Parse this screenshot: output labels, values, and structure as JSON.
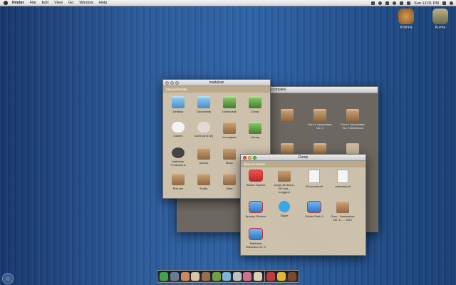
{
  "menubar": {
    "app": "Finder",
    "items": [
      "File",
      "Edit",
      "View",
      "Go",
      "Window",
      "Help"
    ],
    "clock": "Sun 12:01 PM"
  },
  "desktop": {
    "icons": [
      {
        "label": "Krishna"
      },
      {
        "label": "Kurma"
      }
    ]
  },
  "win_mattahan": {
    "title": "mattahan",
    "sidebar_header": "Shared Folder",
    "items": [
      {
        "label": "Desktop",
        "icon": "folder-blue"
      },
      {
        "label": "Documents",
        "icon": "folder-blue"
      },
      {
        "label": "Downloads",
        "icon": "folder-green"
      },
      {
        "label": "Dump",
        "icon": "folder-green"
      },
      {
        "label": "Games",
        "icon": "glove"
      },
      {
        "label": "Icons (and Wi)",
        "icon": "bird"
      },
      {
        "label": "Incomplete",
        "icon": "folder"
      },
      {
        "label": "Library",
        "icon": "folder-green"
      },
      {
        "label": "Mattahan Productions",
        "icon": "dark"
      },
      {
        "label": "Movies",
        "icon": "folder"
      },
      {
        "label": "Music",
        "icon": "folder"
      },
      {
        "label": "Pictures",
        "icon": "folder"
      },
      {
        "label": "Public",
        "icon": "folder"
      },
      {
        "label": "Sites",
        "icon": "folder"
      }
    ]
  },
  "win_incomplete": {
    "title": "Incomplete",
    "items": [
      {
        "label": "",
        "sub": ""
      },
      {
        "label": "Guru's Jazzmatazz Vol. 4",
        "sub": "21 items"
      },
      {
        "label": "Guru's Jazzmatazz Vol. 3 Streetsoul",
        "sub": ""
      },
      {
        "label": "Jan 4 - American Gangster [2007]",
        "sub": "6 items"
      }
    ]
  },
  "win_dump": {
    "title": "Dump",
    "sidebar_header": "Shared Folder",
    "items": [
      {
        "label": "Sticker System",
        "icon": "cup-red"
      },
      {
        "label": "Jungle Brothers - VIP (we... mogged)",
        "icon": "folder"
      },
      {
        "label": "R1/sched.pdf",
        "icon": "paper"
      },
      {
        "label": "calendar.pdf",
        "icon": "paper"
      },
      {
        "label": "Spooky Stickers",
        "icon": "cup-blue"
      },
      {
        "label": "Skype",
        "icon": "skype"
      },
      {
        "label": "Sticker Pack 1",
        "icon": "cup-blue"
      },
      {
        "label": "Guru - Jazzmatazz Vol. 4 - ... 2007",
        "icon": "folder"
      },
      {
        "label": "Battlestar Galactica Vol. 3",
        "icon": "cup-blue"
      }
    ]
  },
  "colors": {
    "desktop": "#2b5a98",
    "linen": "#cfc3ad",
    "dark_window": "#6c6760",
    "folder": "#a57d52"
  }
}
